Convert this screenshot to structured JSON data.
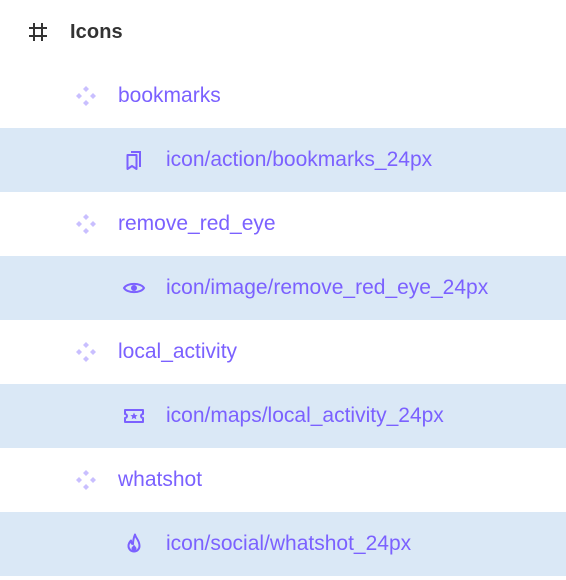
{
  "frame": {
    "icon": "frame-hash-icon",
    "label": "Icons"
  },
  "items": [
    {
      "component_icon": "component-diamond-icon",
      "component_label": "bookmarks",
      "instance_icon": "bookmarks-icon",
      "instance_label": "icon/action/bookmarks_24px",
      "selected": true
    },
    {
      "component_icon": "component-diamond-icon",
      "component_label": "remove_red_eye",
      "instance_icon": "eye-icon",
      "instance_label": "icon/image/remove_red_eye_24px",
      "selected": true
    },
    {
      "component_icon": "component-diamond-icon",
      "component_label": "local_activity",
      "instance_icon": "ticket-icon",
      "instance_label": "icon/maps/local_activity_24px",
      "selected": true
    },
    {
      "component_icon": "component-diamond-icon",
      "component_label": "whatshot",
      "instance_icon": "flame-icon",
      "instance_label": "icon/social/whatshot_24px",
      "selected": true
    }
  ],
  "colors": {
    "component": "#7b61ff",
    "component_icon_faded": "#c9bfff",
    "selection_background": "#dae8f6",
    "frame_text": "#333333"
  }
}
